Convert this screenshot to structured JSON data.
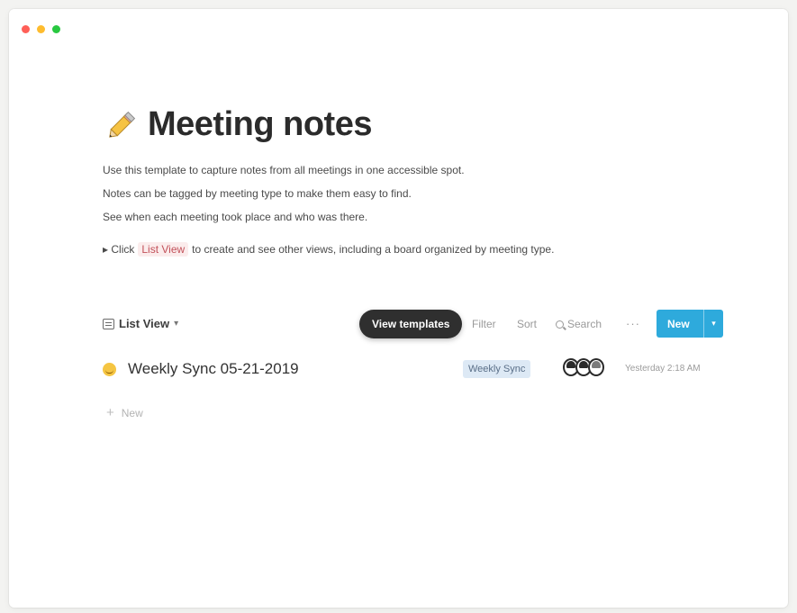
{
  "window": {
    "controls": [
      {
        "name": "close",
        "color": "#ff5f57"
      },
      {
        "name": "minimize",
        "color": "#febc2e"
      },
      {
        "name": "zoom",
        "color": "#28c840"
      }
    ]
  },
  "page": {
    "icon": "pencil-icon",
    "title": "Meeting notes",
    "description": [
      "Use this template to capture notes from all meetings in one accessible spot.",
      "Notes can be tagged by meeting type to make them easy to find.",
      "See when each meeting took place and who was there."
    ],
    "tip": {
      "prefix": "▸ Click",
      "link": "List View",
      "suffix": "to create and see other views, including a board organized by meeting type."
    }
  },
  "toolbar": {
    "view_label": "List View",
    "view_caret": "▾",
    "tooltip": "View templates",
    "filter": "Filter",
    "sort": "Sort",
    "search": "Search",
    "more": "···",
    "new_label": "New",
    "new_caret": "▾",
    "accent": "#2eaadc"
  },
  "rows": [
    {
      "icon": "smiley-icon",
      "title": "Weekly Sync 05-21-2019",
      "tag": "Weekly Sync",
      "date": "Yesterday 2:18 AM"
    }
  ],
  "add_new": {
    "plus": "+",
    "label": "New"
  }
}
